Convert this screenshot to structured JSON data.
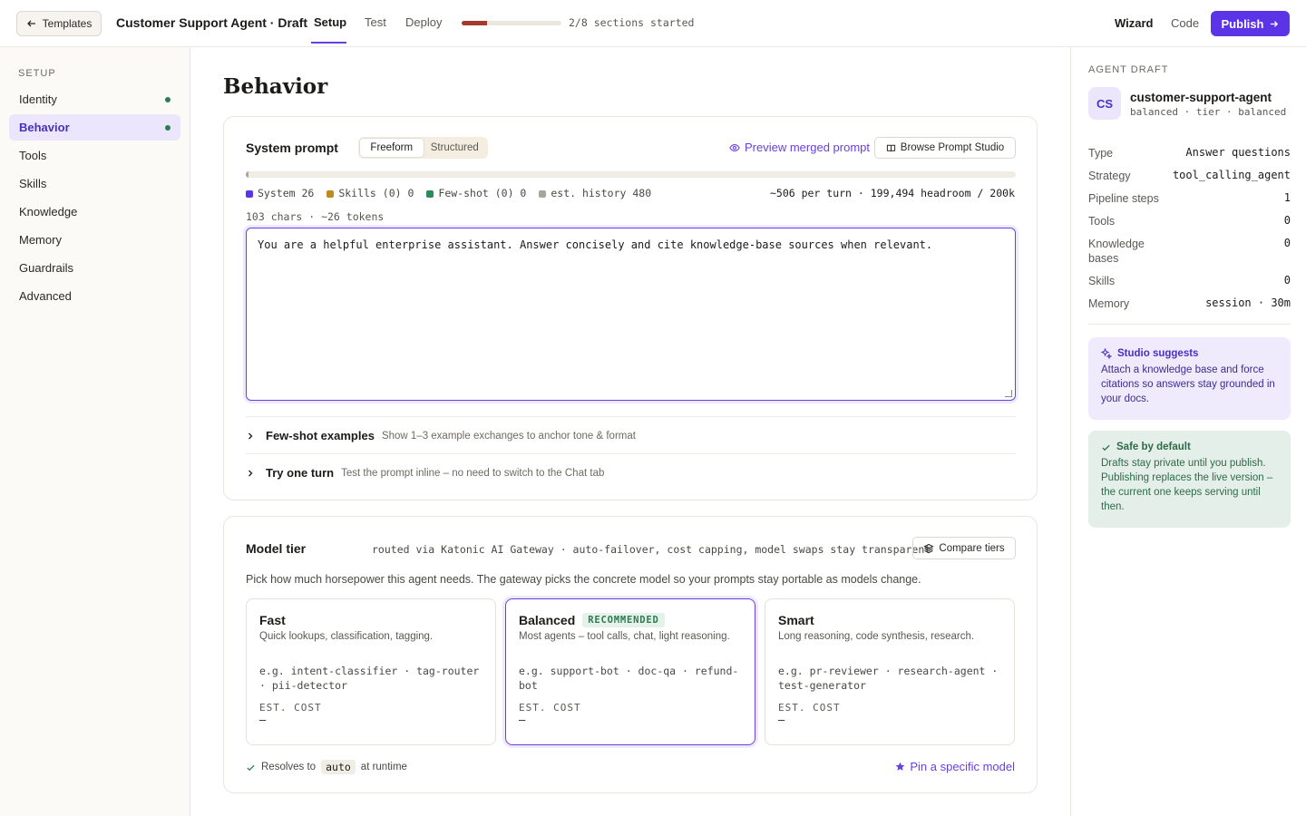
{
  "header": {
    "back_label": "Templates",
    "title": "Customer Support Agent · Draft",
    "tabs": [
      {
        "label": "Setup"
      },
      {
        "label": "Test"
      },
      {
        "label": "Deploy"
      }
    ],
    "progress": {
      "value": 0.25,
      "text": "2/8 sections started"
    },
    "mode_wizard": "Wizard",
    "mode_code": "Code",
    "publish_label": "Publish"
  },
  "sidebar": {
    "heading": "SETUP",
    "items": [
      {
        "label": "Identity"
      },
      {
        "label": "Behavior"
      },
      {
        "label": "Tools"
      },
      {
        "label": "Skills"
      },
      {
        "label": "Knowledge"
      },
      {
        "label": "Memory"
      },
      {
        "label": "Guardrails"
      },
      {
        "label": "Advanced"
      }
    ]
  },
  "main": {
    "title": "Behavior",
    "system_prompt": {
      "title": "System prompt",
      "mode_freeform": "Freeform",
      "mode_structured": "Structured",
      "preview_link": "Preview merged prompt",
      "browse_button": "Browse Prompt Studio",
      "token_legend": [
        {
          "label": "System 26",
          "color": "#5b34e8"
        },
        {
          "label": "Skills (0) 0",
          "color": "#c08a1e"
        },
        {
          "label": "Few-shot (0) 0",
          "color": "#2f8a5a"
        },
        {
          "label": "est. history 480",
          "color": "#a9a59c"
        }
      ],
      "token_summary": "~506 per turn · 199,494 headroom / 200k",
      "char_count": "103 chars · ~26 tokens",
      "prompt_text": "You are a helpful enterprise assistant. Answer concisely and cite knowledge-base sources when relevant.",
      "few_shot_title": "Few-shot examples",
      "few_shot_desc": "Show 1–3 example exchanges to anchor tone & format",
      "try_title": "Try one turn",
      "try_desc": "Test the prompt inline – no need to switch to the Chat tab"
    },
    "model_tier": {
      "title": "Model tier",
      "route_text": "routed via Katonic AI Gateway · auto-failover, cost capping, model swaps stay transparent",
      "compare_button": "Compare tiers",
      "description": "Pick how much horsepower this agent needs. The gateway picks the concrete model so your prompts stay portable as models change.",
      "tiers": [
        {
          "name": "Fast",
          "badge": "",
          "sub": "Quick lookups, classification, tagging.",
          "examples": "e.g. intent-classifier · tag-router · pii-detector",
          "cost_label": "EST. COST",
          "cost_value": "—"
        },
        {
          "name": "Balanced",
          "badge": "RECOMMENDED",
          "sub": "Most agents – tool calls, chat, light reasoning.",
          "examples": "e.g. support-bot · doc-qa · refund-bot",
          "cost_label": "EST. COST",
          "cost_value": "—"
        },
        {
          "name": "Smart",
          "badge": "",
          "sub": "Long reasoning, code synthesis, research.",
          "examples": "e.g. pr-reviewer · research-agent · test-generator",
          "cost_label": "EST. COST",
          "cost_value": "—"
        }
      ],
      "resolves_prefix": "Resolves to",
      "resolves_value": "auto",
      "resolves_suffix": "at runtime",
      "pin_link": "Pin a specific model"
    }
  },
  "right_panel": {
    "heading": "AGENT DRAFT",
    "avatar_initials": "CS",
    "agent_name": "customer-support-agent",
    "agent_meta": "balanced · tier · balanced",
    "properties": [
      {
        "key": "Type",
        "value": "Answer questions"
      },
      {
        "key": "Strategy",
        "value": "tool_calling_agent"
      },
      {
        "key": "Pipeline steps",
        "value": "1"
      },
      {
        "key": "Tools",
        "value": "0"
      },
      {
        "key": "Knowledge bases",
        "value": "0"
      },
      {
        "key": "Skills",
        "value": "0"
      },
      {
        "key": "Memory",
        "value": "session · 30m"
      }
    ],
    "suggest_title": "Studio suggests",
    "suggest_body": "Attach a knowledge base and force citations so answers stay grounded in your docs.",
    "safe_title": "Safe by default",
    "safe_body": "Drafts stay private until you publish. Publishing replaces the live version – the current one keeps serving until then."
  },
  "colors": {
    "accent": "#5b34e8",
    "progress": "#a33a2c",
    "success": "#2f7a53"
  }
}
